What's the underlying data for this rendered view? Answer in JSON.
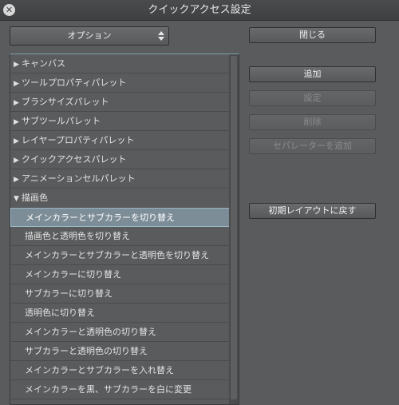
{
  "window": {
    "title": "クイックアクセス設定"
  },
  "dropdown": {
    "selected": "オプション"
  },
  "buttons": {
    "close": "閉じる",
    "add": "追加",
    "settings": "設定",
    "delete": "削除",
    "add_separator": "セパレーターを追加",
    "reset_layout": "初期レイアウトに戻す"
  },
  "tree": {
    "collapsed": [
      "キャンバス",
      "ツールプロパティパレット",
      "ブラシサイズパレット",
      "サブツールパレット",
      "レイヤープロパティパレット",
      "クイックアクセスパレット",
      "アニメーションセルパレット"
    ],
    "expanded": "描画色",
    "children": [
      "メインカラーとサブカラーを切り替え",
      "描画色と透明色を切り替え",
      "メインカラーとサブカラーと透明色を切り替え",
      "メインカラーに切り替え",
      "サブカラーに切り替え",
      "透明色に切り替え",
      "メインカラーと透明色の切り替え",
      "サブカラーと透明色の切り替え",
      "メインカラーとサブカラーを入れ替え",
      "メインカラーを黒、サブカラーを白に変更"
    ]
  }
}
